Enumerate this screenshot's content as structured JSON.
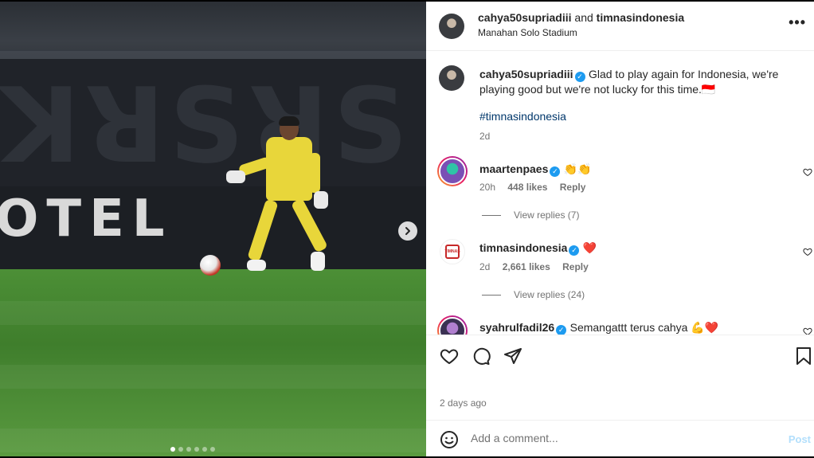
{
  "post": {
    "header": {
      "user1": "cahya50supriadiii",
      "and": "and",
      "user2": "timnasindonesia",
      "location": "Manahan Solo Stadium"
    },
    "media": {
      "board_text": "OTEL",
      "dots_total": 6,
      "active_dot": 1
    },
    "caption": {
      "username": "cahya50supriadiii",
      "text": "Glad to play again for Indonesia, we're playing good but we're not lucky for this time.🇮🇩",
      "hashtag": "#timnasindonesia",
      "time": "2d"
    },
    "comments": [
      {
        "username": "maartenpaes",
        "text": "👏👏",
        "time": "20h",
        "likes": "448 likes",
        "reply": "Reply",
        "view_replies": "View replies (7)"
      },
      {
        "username": "timnasindonesia",
        "text": "❤️",
        "time": "2d",
        "likes": "2,661 likes",
        "reply": "Reply",
        "view_replies": "View replies (24)"
      },
      {
        "username": "syahrulfadil26",
        "text": "Semangattt terus cahya 💪❤️"
      }
    ],
    "date": "2 days ago",
    "add_comment_placeholder": "Add a comment...",
    "post_label": "Post",
    "colors": {
      "link": "#00376b",
      "verified": "#1d9bf0",
      "post_button": "#b2dffc"
    }
  }
}
